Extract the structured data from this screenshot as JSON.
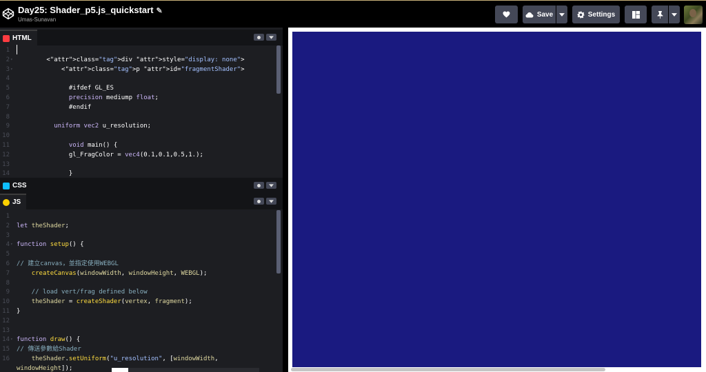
{
  "header": {
    "title": "Day25: Shader_p5.js_quickstart",
    "author": "Umas-Sunavan",
    "save_label": "Save",
    "settings_label": "Settings"
  },
  "panels": {
    "html_label": "HTML",
    "css_label": "CSS",
    "js_label": "JS"
  },
  "html_code": [
    {
      "n": "1",
      "fold": "",
      "text": ""
    },
    {
      "n": "2",
      "fold": "▾",
      "text": "        <div style=\"display: none\">"
    },
    {
      "n": "3",
      "fold": "▾",
      "text": "            <p id=\"fragmentShader\">"
    },
    {
      "n": "4",
      "fold": "",
      "text": ""
    },
    {
      "n": "5",
      "fold": "",
      "text": "              #ifdef GL_ES"
    },
    {
      "n": "6",
      "fold": "",
      "text": "              precision mediump float;"
    },
    {
      "n": "7",
      "fold": "",
      "text": "              #endif"
    },
    {
      "n": "8",
      "fold": "",
      "text": ""
    },
    {
      "n": "9",
      "fold": "",
      "text": "          uniform vec2 u_resolution;"
    },
    {
      "n": "10",
      "fold": "",
      "text": ""
    },
    {
      "n": "11",
      "fold": "",
      "text": "              void main() {"
    },
    {
      "n": "12",
      "fold": "",
      "text": "              gl_FragColor = vec4(0.1,0.1,0.5,1.);"
    },
    {
      "n": "13",
      "fold": "",
      "text": ""
    },
    {
      "n": "14",
      "fold": "",
      "text": "              }"
    }
  ],
  "js_code": [
    {
      "n": "1",
      "fold": "",
      "text": ""
    },
    {
      "n": "2",
      "fold": "",
      "text": "let theShader;"
    },
    {
      "n": "3",
      "fold": "",
      "text": ""
    },
    {
      "n": "4",
      "fold": "▾",
      "text": "function setup() {"
    },
    {
      "n": "5",
      "fold": "",
      "text": ""
    },
    {
      "n": "6",
      "fold": "",
      "text": "// 建立canvas，並指定使用WEBGL"
    },
    {
      "n": "7",
      "fold": "",
      "text": "    createCanvas(windowWidth, windowHeight, WEBGL);"
    },
    {
      "n": "8",
      "fold": "",
      "text": ""
    },
    {
      "n": "9",
      "fold": "",
      "text": "    // load vert/frag defined below"
    },
    {
      "n": "10",
      "fold": "",
      "text": "    theShader = createShader(vertex, fragment);"
    },
    {
      "n": "11",
      "fold": "",
      "text": "}"
    },
    {
      "n": "12",
      "fold": "",
      "text": ""
    },
    {
      "n": "13",
      "fold": "",
      "text": ""
    },
    {
      "n": "14",
      "fold": "▾",
      "text": "function draw() {"
    },
    {
      "n": "15",
      "fold": "",
      "text": "// 傳送參數給Shader"
    },
    {
      "n": "16",
      "fold": "",
      "text": "    theShader.setUniform(\"u_resolution\", [windowWidth,"
    },
    {
      "n": "",
      "fold": "",
      "text": "windowHeight]);"
    }
  ],
  "colors": {
    "canvas": "#1a1a80",
    "editor_bg": "#1d1e22",
    "header_bg": "#000000",
    "button_bg": "#444857"
  }
}
